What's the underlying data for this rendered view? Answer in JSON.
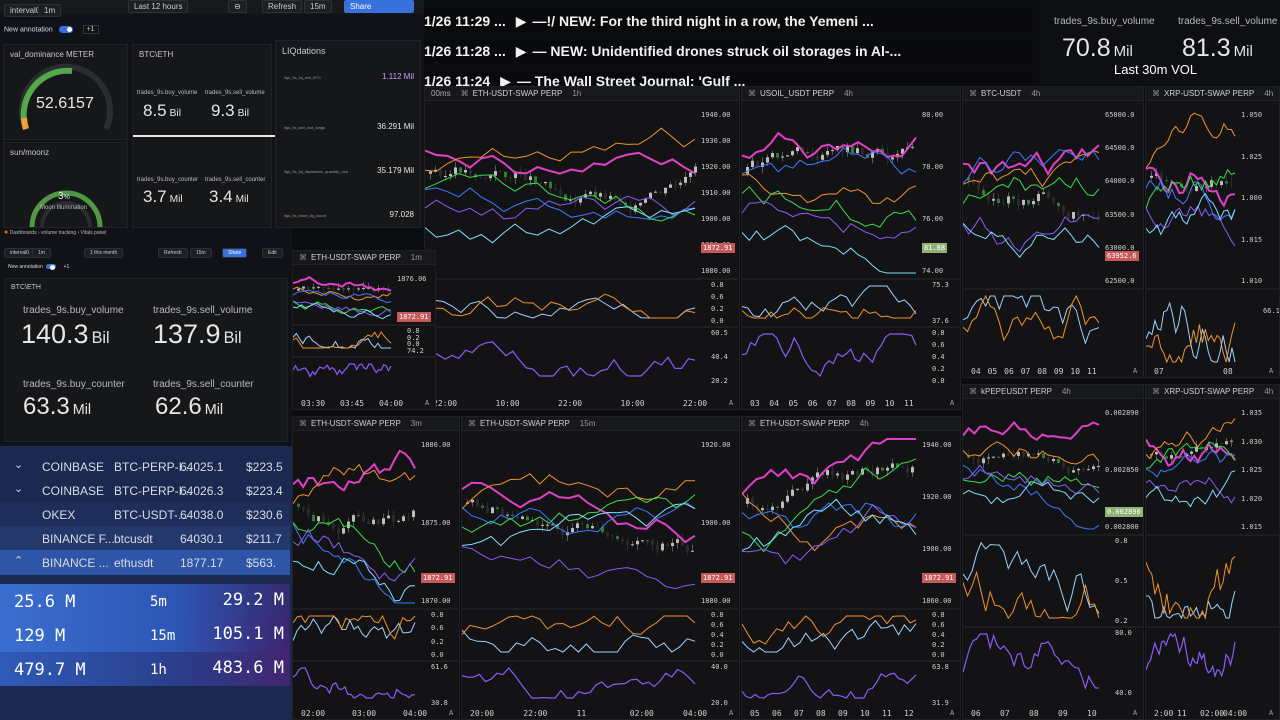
{
  "colors": {
    "accent": "#3871dc",
    "green_gauge": "#56a64b",
    "price_tag_red": "#c65a5a",
    "price_tag_green": "#8fb173",
    "purple": "#8a5cf6",
    "magenta": "#e040c8",
    "orange": "#f0932b",
    "cyan": "#7fe0ff",
    "green_line": "#3ddc4a",
    "blue_line": "#3b7bff"
  },
  "top_dashboard": {
    "var_interval_label": "interval0",
    "var_interval_value": "1m",
    "annotation_label": "New annotation",
    "plus_one": "+1",
    "time_range": "Last 12 hours",
    "refresh_label": "Refresh",
    "refresh_interval": "15m",
    "share_label": "Share",
    "gauge1_title": "val_dominance METER",
    "gauge1_value": "52.6157",
    "gauge2_title": "sun/moonz",
    "gauge2_value": "3",
    "gauge2_unit": "%",
    "gauge2_sub": "Moon Illumination",
    "btceth_title": "BTC\\ETH",
    "buy_volume_label": "trades_9s.buy_volume",
    "sell_volume_label": "trades_9s.sell_volume",
    "buy_volume_value": "8.5",
    "buy_volume_unit": "Bil",
    "sell_volume_value": "9.3",
    "sell_volume_unit": "Bil",
    "buy_counter_label": "trades_9s.buy_counter",
    "sell_counter_label": "trades_9s.sell_counter",
    "buy_counter_value": "3.7",
    "buy_counter_unit": "Mil",
    "sell_counter_value": "3.4",
    "sell_counter_unit": "Mil",
    "liq_title": "LIQdations",
    "liq_rows": [
      {
        "label": "liqs_9s_liq_sell_BTC",
        "value": "1.112 Mil"
      },
      {
        "label": "liqs_9s_sell_usd_longs",
        "value": "36.291 Mil"
      },
      {
        "label": "liqs_9s_liq_liquidation_quantity_usd",
        "value": "35.179 Mil"
      },
      {
        "label": "liqs_9s_short_liq_count",
        "value": "97.028"
      }
    ]
  },
  "second_dashboard": {
    "breadcrumb": [
      "Dashboards",
      "volume tracking",
      "Vitals panel"
    ],
    "var_interval_label": "interval0",
    "var_interval_value": "1m",
    "time_range": "1 this month",
    "refresh_label": "Refresh",
    "refresh_interval": "15m",
    "share_label": "Share",
    "edit_label": "Edit",
    "annotation_label": "New annotation",
    "plus_one": "+1",
    "panel_title": "BTC\\ETH",
    "buy_volume_label": "trades_9s.buy_volume",
    "sell_volume_label": "trades_9s.sell_volume",
    "buy_volume_value": "140.3",
    "buy_volume_unit": "Bil",
    "sell_volume_value": "137.9",
    "sell_volume_unit": "Bil",
    "buy_counter_label": "trades_9s.buy_counter",
    "sell_counter_label": "trades_9s.sell_counter",
    "buy_counter_value": "63.3",
    "buy_counter_unit": "Mil",
    "sell_counter_value": "62.6",
    "sell_counter_unit": "Mil"
  },
  "news": [
    {
      "time": "1/26 11:29 ...",
      "text": "—!⁠/⁠ NEW: For the third night in a row, the Yemeni ..."
    },
    {
      "time": "1/26 11:28 ...",
      "text": "— NEW: Unidentified drones struck oil storages in Al-..."
    },
    {
      "time": "1/26 11:24",
      "text": "— The Wall Street Journal: 'Gulf ..."
    }
  ],
  "top_right": {
    "buy_volume_label": "trades_9s.buy_volume",
    "sell_volume_label": "trades_9s.sell_volume",
    "buy_volume_value": "70.8",
    "buy_volume_unit": "Mil",
    "sell_volume_value": "81.3",
    "sell_volume_unit": "Mil",
    "caption": "Last 30m VOL"
  },
  "orderbook": [
    {
      "exchange": "COINBASE",
      "symbol": "BTC-PERP-I...",
      "price": "64025.1",
      "size": "$223.5"
    },
    {
      "exchange": "COINBASE",
      "symbol": "BTC-PERP-I...",
      "price": "64026.3",
      "size": "$223.4"
    },
    {
      "exchange": "OKEX",
      "symbol": "BTC-USDT-...",
      "price": "64038.0",
      "size": "$230.6"
    },
    {
      "exchange": "BINANCE F...",
      "symbol": "btcusdt",
      "price": "64030.1",
      "size": "$211.7"
    },
    {
      "exchange": "BINANCE ...",
      "symbol": "ethusdt",
      "price": "1877.17",
      "size": "$563."
    }
  ],
  "volume_rows": [
    {
      "left": "25.6 M",
      "period": "5m",
      "right": "29.2 M"
    },
    {
      "left": "129 M",
      "period": "15m",
      "right": "105.1 M"
    },
    {
      "left": "479.7 M",
      "period": "1h",
      "right": "483.6 M"
    }
  ],
  "charts": {
    "eth_1h": {
      "symbol": "ETH-USDT-SWAP PERP",
      "tf": "1h",
      "tf_prefix": "00ms",
      "yticks": [
        "1940.00",
        "1930.00",
        "1920.00",
        "1910.00",
        "1900.00",
        "1890.00",
        "1880.00"
      ],
      "price_tag": "1872.91",
      "osc1_ticks": [
        "0.8",
        "0.6",
        "0.2",
        "0.0"
      ],
      "osc2_ticks": [
        "60.5",
        "40.4",
        "20.2"
      ],
      "xticks": [
        "22:00",
        "10:00",
        "22:00",
        "10:00",
        "22:00"
      ]
    },
    "usoil_4h": {
      "symbol": "USOIL_USDT PERP",
      "tf": "4h",
      "yticks": [
        "80.00",
        "78.00",
        "76.00",
        "74.00"
      ],
      "price_tag": "81.88",
      "osc1_ticks": [
        "75.3",
        "37.6"
      ],
      "osc2_ticks": [
        "0.8",
        "0.6",
        "0.4",
        "0.2",
        "0.0"
      ],
      "xticks": [
        "03",
        "04",
        "05",
        "06",
        "07",
        "08",
        "09",
        "10",
        "11"
      ]
    },
    "btc_4h": {
      "symbol": "BTC-USDT",
      "tf": "4h",
      "yticks": [
        "65000.0",
        "64500.0",
        "64000.0",
        "63500.0",
        "63000.0",
        "62500.0"
      ],
      "price_tag": "63952.6",
      "xticks": [
        "04",
        "05",
        "06",
        "07",
        "08",
        "09",
        "10",
        "11"
      ]
    },
    "xrp_4h_top": {
      "symbol": "XRP-USDT-SWAP PERP",
      "tf": "4h",
      "yticks": [
        "1.050",
        "1.025",
        "1.000",
        "1.015",
        "1.010"
      ],
      "osc_tick": "66.1",
      "xticks": [
        "07",
        "08"
      ]
    },
    "eth_1m": {
      "symbol": "ETH-USDT-SWAP PERP",
      "tf": "1m",
      "yticks": [
        "1876.06"
      ],
      "price_tag": "1872.91",
      "osc_ticks": [
        "0.8",
        "0.2",
        "0.0",
        "74.2"
      ],
      "xticks": [
        "03:30",
        "03:45",
        "04:00"
      ]
    },
    "eth_3m": {
      "symbol": "ETH-USDT-SWAP PERP",
      "tf": "3m",
      "yticks": [
        "1880.00",
        "1875.00",
        "1870.00"
      ],
      "price_tag": "1872.91",
      "osc1_ticks": [
        "0.8",
        "0.6",
        "0.2",
        "0.0"
      ],
      "osc2_ticks": [
        "61.6",
        "30.8"
      ],
      "xticks": [
        "02:00",
        "03:00",
        "04:00"
      ]
    },
    "eth_15m": {
      "symbol": "ETH-USDT-SWAP PERP",
      "tf": "15m",
      "yticks": [
        "1920.00",
        "1900.00",
        "1880.00"
      ],
      "price_tag": "1872.91",
      "osc1_ticks": [
        "0.8",
        "0.6",
        "0.4",
        "0.2",
        "0.0"
      ],
      "osc2_ticks": [
        "40.0",
        "20.0"
      ],
      "xticks": [
        "20:00",
        "22:00",
        "11",
        "02:00",
        "04:00"
      ]
    },
    "eth_4h": {
      "symbol": "ETH-USDT-SWAP PERP",
      "tf": "4h",
      "yticks": [
        "1940.00",
        "1920.00",
        "1900.00",
        "1860.00"
      ],
      "price_tag": "1872.91",
      "osc1_ticks": [
        "0.8",
        "0.6",
        "0.4",
        "0.2",
        "0.0"
      ],
      "osc2_ticks": [
        "63.8",
        "31.9"
      ],
      "xticks": [
        "05",
        "06",
        "07",
        "08",
        "09",
        "10",
        "11",
        "12"
      ]
    },
    "pepe_4h": {
      "symbol": "kPEPEUSDT PERP",
      "tf": "4h",
      "yticks": [
        "0.002890",
        "0.002850",
        "0.002800"
      ],
      "price_tag": "0.002890",
      "osc1_ticks": [
        "0.8",
        "0.5",
        "0.2"
      ],
      "osc2_ticks": [
        "80.0",
        "40.0"
      ],
      "xticks": [
        "06",
        "07",
        "08",
        "09",
        "10"
      ]
    },
    "xrp_4h_bottom": {
      "symbol": "XRP-USDT-SWAP PERP",
      "tf": "4h",
      "yticks": [
        "1.035",
        "1.030",
        "1.025",
        "1.020",
        "1.015"
      ],
      "xticks": [
        "2:00",
        "11",
        "02:00",
        "04:00"
      ]
    }
  }
}
